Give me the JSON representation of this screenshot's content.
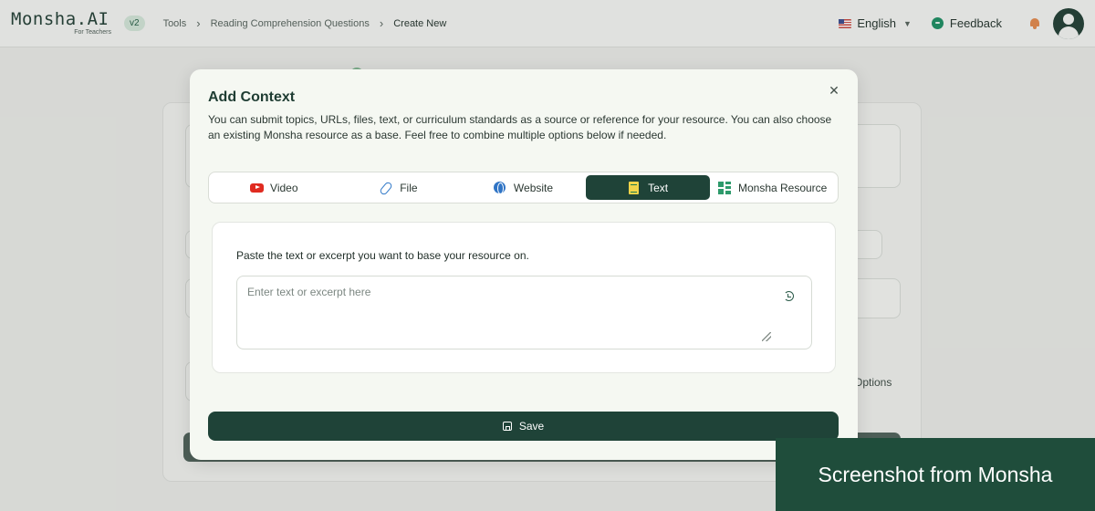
{
  "header": {
    "logo": "Monsha.AI",
    "logo_sub": "For Teachers",
    "version": "v2",
    "breadcrumbs": [
      "Tools",
      "Reading Comprehension Questions",
      "Create New"
    ],
    "language": "English",
    "feedback": "Feedback"
  },
  "background": {
    "options_label": "Options"
  },
  "modal": {
    "title": "Add Context",
    "description": "You can submit topics, URLs, files, text, or curriculum standards as a source or reference for your resource. You can also choose an existing Monsha resource as a base. Feel free to combine multiple options below if needed.",
    "tabs": [
      {
        "label": "Video",
        "icon": "youtube-icon"
      },
      {
        "label": "File",
        "icon": "paperclip-icon"
      },
      {
        "label": "Website",
        "icon": "globe-icon"
      },
      {
        "label": "Text",
        "icon": "document-icon",
        "active": true
      },
      {
        "label": "Monsha Resource",
        "icon": "grid-icon"
      }
    ],
    "text_panel": {
      "label": "Paste the text or excerpt you want to base your resource on.",
      "placeholder": "Enter text or excerpt here",
      "value": ""
    },
    "save_label": "Save"
  },
  "watermark": "Screenshot from Monsha",
  "colors": {
    "primary": "#1f4338",
    "modal_bg": "#f5f8f2",
    "watermark_bg": "#1f4d3b"
  }
}
